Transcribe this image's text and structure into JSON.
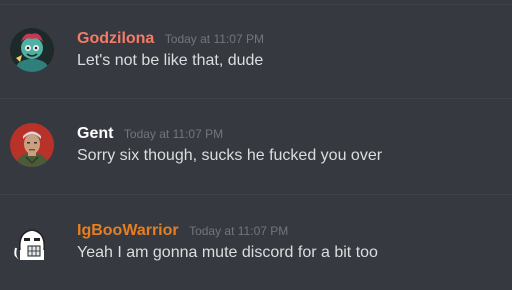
{
  "messages": [
    {
      "username": "Godzilona",
      "username_color": "#f47b67",
      "timestamp": "Today at 11:07 PM",
      "text": "Let's not be like that, dude",
      "avatar_icon": "zombie-character-avatar"
    },
    {
      "username": "Gent",
      "username_color": "#ffffff",
      "timestamp": "Today at 11:07 PM",
      "text": "Sorry six though, sucks he fucked you over",
      "avatar_icon": "uniformed-man-avatar"
    },
    {
      "username": "IgBooWarrior",
      "username_color": "#e67e22",
      "timestamp": "Today at 11:07 PM",
      "text": "Yeah I am gonna mute discord for a bit too",
      "avatar_icon": "meme-face-avatar"
    }
  ]
}
